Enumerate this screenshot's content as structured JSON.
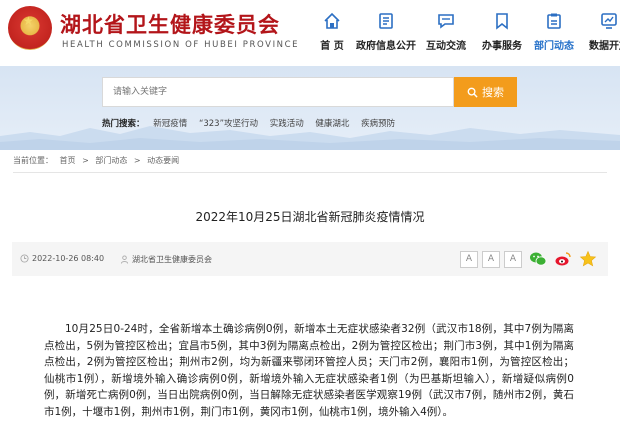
{
  "header": {
    "title_cn": "湖北省卫生健康委员会",
    "title_en": "HEALTH COMMISSION OF HUBEI PROVINCE",
    "nav": [
      {
        "label": "首 页",
        "icon": "home-icon"
      },
      {
        "label": "政府信息公开",
        "icon": "document-icon"
      },
      {
        "label": "互动交流",
        "icon": "chat-icon"
      },
      {
        "label": "办事服务",
        "icon": "bookmark-icon"
      },
      {
        "label": "部门动态",
        "icon": "clipboard-icon"
      },
      {
        "label": "数据开放",
        "icon": "chart-icon"
      }
    ]
  },
  "search": {
    "placeholder": "请输入关键字",
    "button_label": "搜索"
  },
  "hot": {
    "label": "热门搜索：",
    "links": [
      "新冠疫情",
      "“323”攻坚行动",
      "实践活动",
      "健康湖北",
      "疾病预防"
    ]
  },
  "breadcrumb": {
    "prefix": "当前位置：",
    "items": [
      "首页",
      "部门动态",
      "动态要闻"
    ],
    "sep": ">"
  },
  "article": {
    "title": "2022年10月25日湖北省新冠肺炎疫情情况",
    "date": "2022-10-26 08:40",
    "source": "湖北省卫生健康委员会",
    "font_buttons": [
      "A",
      "A",
      "A"
    ],
    "share_icons": [
      "wechat-icon",
      "weibo-icon",
      "favorite-star-icon"
    ],
    "body": "10月25日0-24时，全省新增本土确诊病例0例，新增本土无症状感染者32例（武汉市18例，其中7例为隔离点检出，5例为管控区检出；宜昌市5例，其中3例为隔离点检出，2例为管控区检出；荆门市3例，其中1例为隔离点检出，2例为管控区检出；荆州市2例，均为新疆来鄂闭环管控人员；天门市2例，襄阳市1例，为管控区检出；仙桃市1例），新增境外输入确诊病例0例，新增境外输入无症状感染者1例（为巴基斯坦输入），新增疑似病例0例，新增死亡病例0例，当日出院病例0例，当日解除无症状感染者医学观察19例（武汉市7例，随州市2例，黄石市1例，十堰市1例，荆州市1例，荆门市1例，黄冈市1例，仙桃市1例，境外输入4例）。"
  },
  "colors": {
    "brand_red": "#b3151a",
    "nav_active": "#2470c9",
    "search_orange": "#f39c1c"
  }
}
